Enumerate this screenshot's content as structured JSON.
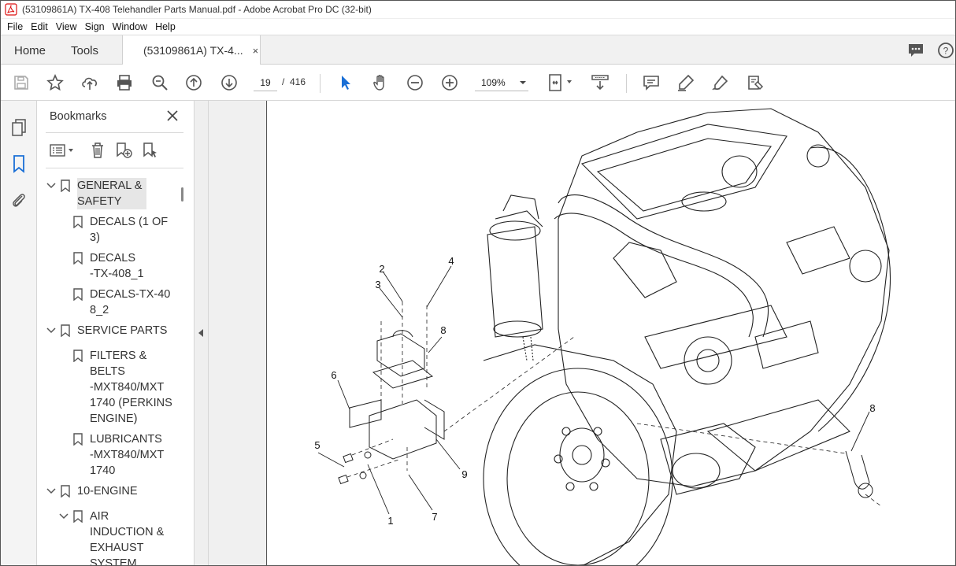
{
  "window": {
    "title": "(53109861A) TX-408 Telehandler Parts Manual.pdf - Adobe Acrobat Pro DC (32-bit)",
    "app_icon": "acrobat-icon"
  },
  "menu": [
    "File",
    "Edit",
    "View",
    "Sign",
    "Window",
    "Help"
  ],
  "tabs": {
    "home": "Home",
    "tools": "Tools",
    "document": "(53109861A) TX-4...",
    "document_close": "×"
  },
  "toolbar": {
    "current_page": "19",
    "page_separator": "/",
    "total_pages": "416",
    "zoom": "109%",
    "icons": [
      "save-icon",
      "star-icon",
      "upload-icon",
      "print-icon",
      "zoom-search-icon",
      "page-up-icon",
      "page-down-icon",
      "select-arrow-icon",
      "hand-icon",
      "zoom-out-icon",
      "zoom-in-icon",
      "fit-page-icon",
      "scroll-mode-icon",
      "comment-icon",
      "highlight-icon",
      "sign-icon",
      "fill-sign-icon"
    ]
  },
  "bookmarks": {
    "header": "Bookmarks",
    "items": [
      {
        "label": "GENERAL &\nSAFETY",
        "level": 0,
        "expanded": true,
        "selected": true
      },
      {
        "label": "DECALS (1 OF\n3)",
        "level": 1
      },
      {
        "label": "DECALS\n-TX-408_1",
        "level": 1
      },
      {
        "label": "DECALS-TX-40\n8_2",
        "level": 1
      },
      {
        "label": "SERVICE PARTS",
        "level": 0,
        "expanded": true
      },
      {
        "label": "FILTERS &\nBELTS\n-MXT840/MXT\n1740 (PERKINS\nENGINE)",
        "level": 1
      },
      {
        "label": "LUBRICANTS\n-MXT840/MXT\n1740",
        "level": 1
      },
      {
        "label": "10-ENGINE",
        "level": 0,
        "expanded": true
      },
      {
        "label": "AIR\nINDUCTION &\nEXHAUST\nSYSTEM",
        "level": 1,
        "expanded": true
      }
    ]
  },
  "diagram": {
    "callouts": [
      "1",
      "2",
      "3",
      "4",
      "5",
      "6",
      "7",
      "8",
      "8",
      "9"
    ]
  }
}
